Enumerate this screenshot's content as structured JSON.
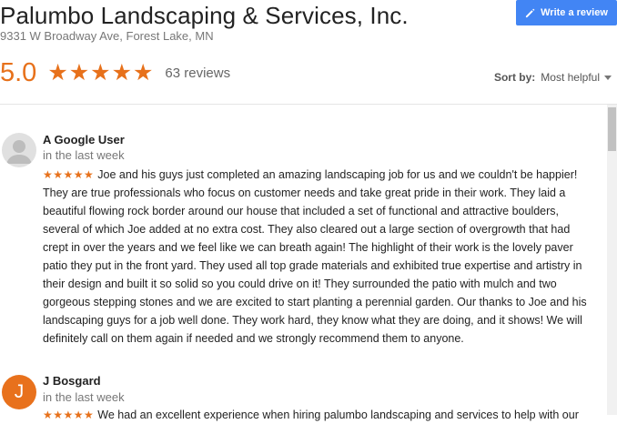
{
  "business": {
    "name": "Palumbo Landscaping & Services, Inc.",
    "address": "9331 W Broadway Ave, Forest Lake, MN",
    "rating": "5.0",
    "stars": "★★★★★",
    "review_count": "63 reviews"
  },
  "actions": {
    "write_review": "Write a review"
  },
  "sort": {
    "label": "Sort by:",
    "selected": "Most helpful"
  },
  "colors": {
    "accent": "#e7711b",
    "button": "#4285f4"
  },
  "reviews": [
    {
      "author": "A Google User",
      "time": "in the last week",
      "stars": "★★★★★",
      "text": "Joe and his guys just completed an amazing landscaping job for us and we couldn't be happier!  They are true professionals who focus on customer needs and take great pride in their work. They laid a beautiful flowing rock border around our house that included a set of functional and attractive boulders, several of which Joe added at no extra cost.  They also cleared out a large section of overgrowth that had crept in over the years and we feel like we can breath again!  The highlight of their work is the lovely paver patio they put in the front yard.  They used all top grade materials and exhibited true expertise and artistry in their design and built it so solid so you could drive on it!  They surrounded the patio with mulch and two gorgeous stepping stones and we are excited to start planting a perennial garden.  Our thanks to Joe and his landscaping guys for a job well done.  They work hard, they know what they are doing, and it shows!  We will definitely call on them again if needed and we strongly recommend them to anyone."
    },
    {
      "author": "J Bosgard",
      "avatar_letter": "J",
      "time": "in the last week",
      "stars": "★★★★★",
      "text": "We had an excellent experience when hiring palumbo landscaping and services to help with our"
    }
  ]
}
